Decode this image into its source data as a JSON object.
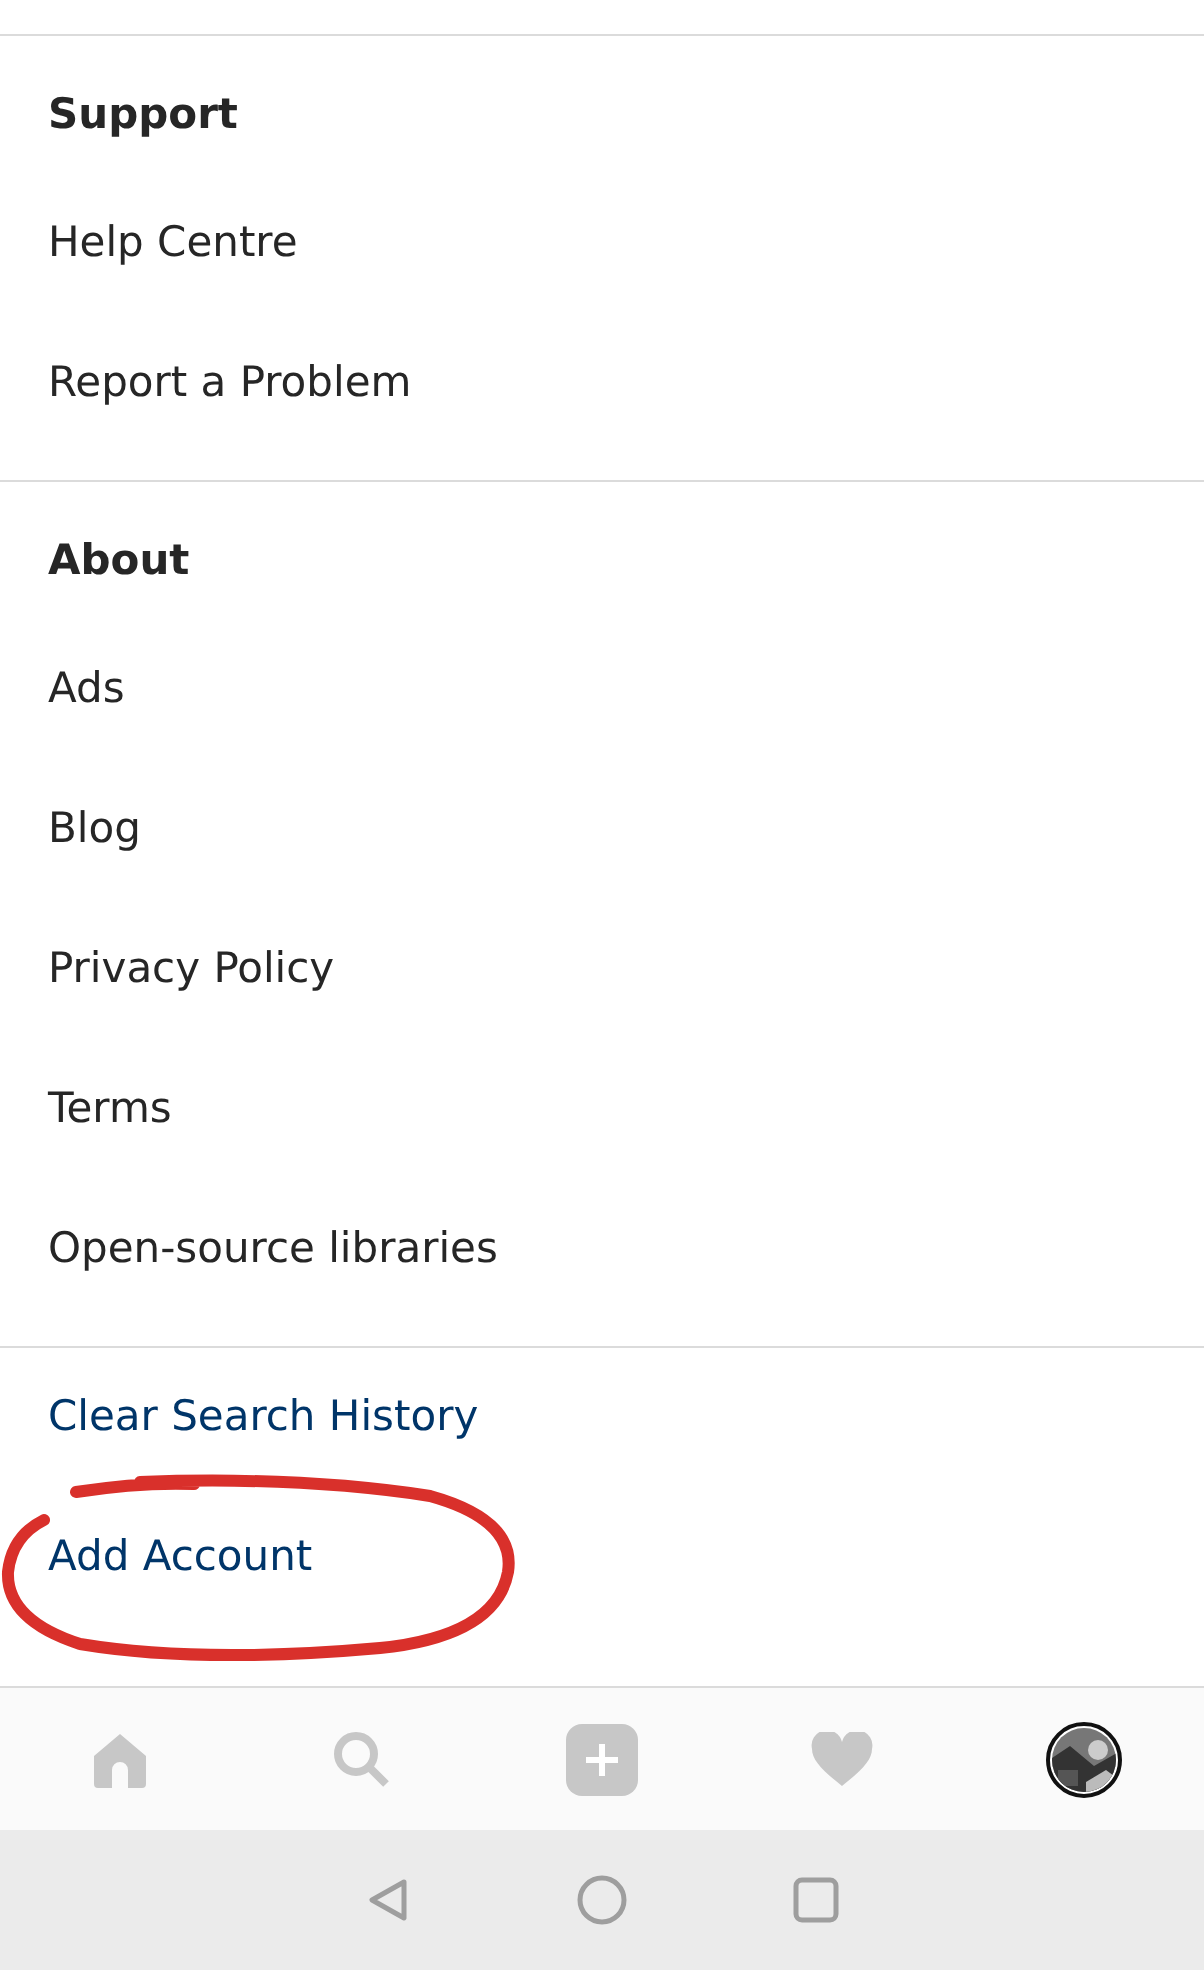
{
  "sections": [
    {
      "heading": "Support",
      "items": [
        {
          "label": "Help Centre",
          "kind": "plain"
        },
        {
          "label": "Report a Problem",
          "kind": "plain"
        }
      ]
    },
    {
      "heading": "About",
      "items": [
        {
          "label": "Ads",
          "kind": "plain"
        },
        {
          "label": "Blog",
          "kind": "plain"
        },
        {
          "label": "Privacy Policy",
          "kind": "plain"
        },
        {
          "label": "Terms",
          "kind": "plain"
        },
        {
          "label": "Open-source libraries",
          "kind": "plain"
        }
      ]
    },
    {
      "items": [
        {
          "label": "Clear Search History",
          "kind": "action"
        },
        {
          "label": "Add Account",
          "kind": "action"
        }
      ]
    }
  ],
  "bottom_nav": [
    {
      "kind": "home",
      "selected": false
    },
    {
      "kind": "search",
      "selected": false
    },
    {
      "kind": "add",
      "selected": false
    },
    {
      "kind": "activity",
      "selected": false
    },
    {
      "kind": "profile",
      "selected": true
    }
  ],
  "system_nav": [
    {
      "kind": "back"
    },
    {
      "kind": "home"
    },
    {
      "kind": "recents"
    }
  ]
}
